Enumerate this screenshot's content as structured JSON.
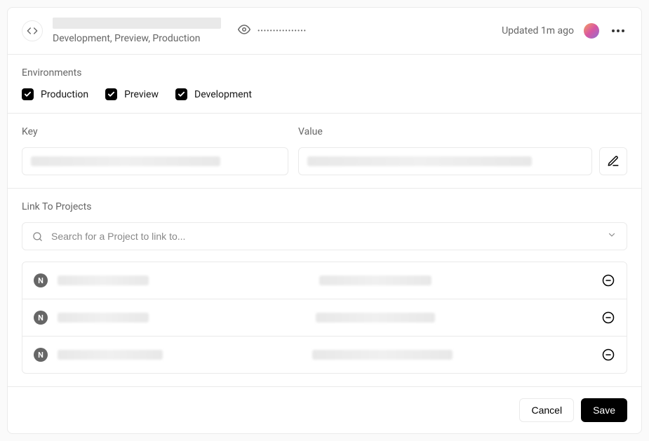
{
  "header": {
    "subtitle": "Development, Preview, Production",
    "masked_value": "••••••••••••••••",
    "updated_text": "Updated 1m ago"
  },
  "environments": {
    "label": "Environments",
    "items": [
      {
        "label": "Production",
        "checked": true
      },
      {
        "label": "Preview",
        "checked": true
      },
      {
        "label": "Development",
        "checked": true
      }
    ]
  },
  "key_value": {
    "key_label": "Key",
    "value_label": "Value"
  },
  "link_projects": {
    "label": "Link To Projects",
    "search_placeholder": "Search for a Project to link to...",
    "projects": [
      {
        "id": "p1"
      },
      {
        "id": "p2"
      },
      {
        "id": "p3"
      }
    ]
  },
  "footer": {
    "cancel": "Cancel",
    "save": "Save"
  }
}
